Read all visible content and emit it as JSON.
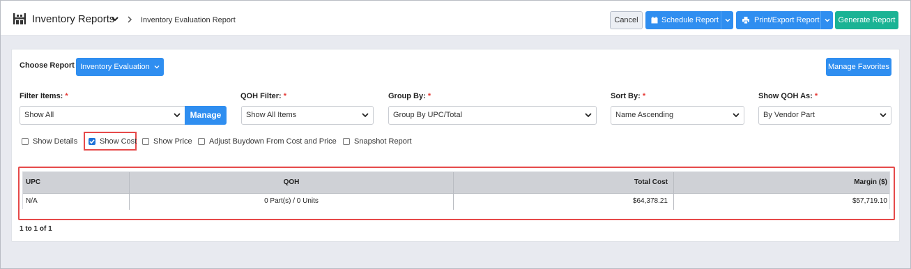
{
  "header": {
    "app_title": "Inventory Reports",
    "breadcrumb": "Inventory Evaluation Report",
    "cancel_label": "Cancel",
    "schedule_label": "Schedule Report",
    "print_label": "Print/Export Report",
    "generate_label": "Generate Report"
  },
  "report": {
    "choose_label": "Choose Report",
    "selected": "Inventory Evaluation",
    "manage_favorites_label": "Manage Favorites"
  },
  "filters": {
    "filter_items": {
      "label": "Filter Items:",
      "value": "Show All",
      "manage_label": "Manage"
    },
    "qoh_filter": {
      "label": "QOH Filter:",
      "value": "Show All Items"
    },
    "group_by": {
      "label": "Group By:",
      "value": "Group By UPC/Total"
    },
    "sort_by": {
      "label": "Sort By:",
      "value": "Name Ascending"
    },
    "show_qoh_as": {
      "label": "Show QOH As:",
      "value": "By Vendor Part"
    },
    "required_mark": "*"
  },
  "options": [
    {
      "label": "Show Details",
      "checked": false
    },
    {
      "label": "Show Cost",
      "checked": true
    },
    {
      "label": "Show Price",
      "checked": false
    },
    {
      "label": "Adjust Buydown From Cost and Price",
      "checked": false
    },
    {
      "label": "Snapshot Report",
      "checked": false
    }
  ],
  "table": {
    "columns": [
      "UPC",
      "QOH",
      "Total Cost",
      "Margin ($)"
    ],
    "rows": [
      [
        "N/A",
        "0 Part(s) / 0 Units",
        "$64,378.21",
        "$57,719.10"
      ]
    ],
    "pager": "1 to 1 of 1"
  },
  "colors": {
    "primary": "#2f8ef0",
    "success": "#1ab394",
    "highlight": "#e64a4a"
  }
}
